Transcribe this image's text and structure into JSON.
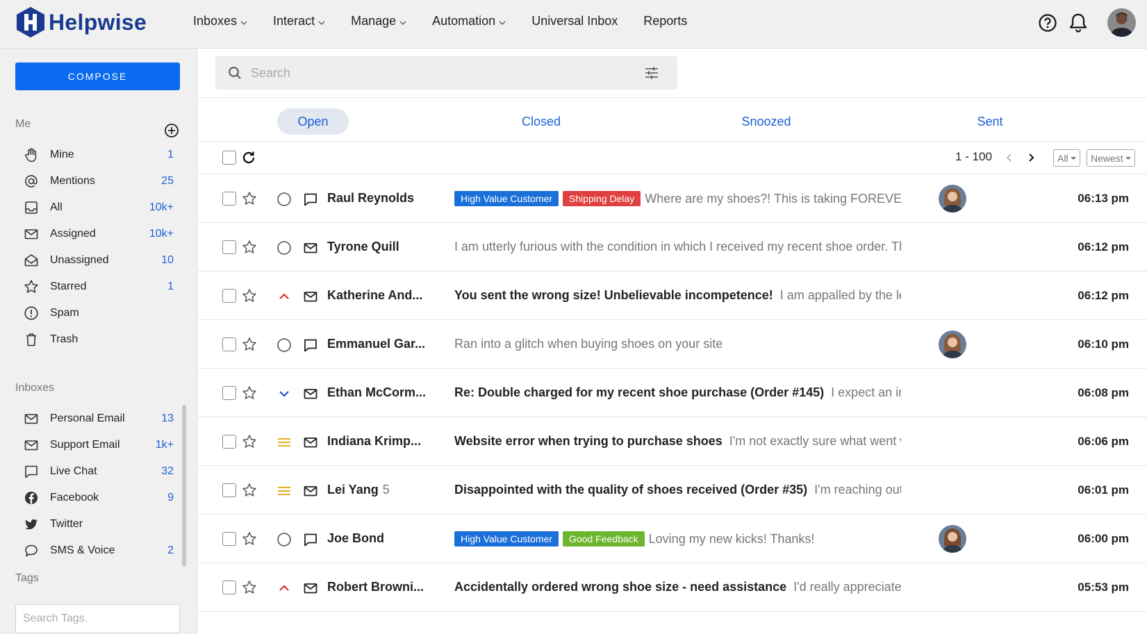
{
  "app": {
    "name": "Helpwise",
    "brand_color": "#1a3a8f",
    "accent_color": "#0a6bf0"
  },
  "nav": [
    {
      "label": "Inboxes",
      "dropdown": true
    },
    {
      "label": "Interact",
      "dropdown": true
    },
    {
      "label": "Manage",
      "dropdown": true
    },
    {
      "label": "Automation",
      "dropdown": true
    },
    {
      "label": "Universal Inbox",
      "dropdown": false
    },
    {
      "label": "Reports",
      "dropdown": false
    }
  ],
  "sidebar": {
    "compose_label": "COMPOSE",
    "me_label": "Me",
    "me_items": [
      {
        "label": "Mine",
        "count": "1",
        "icon": "hand-icon"
      },
      {
        "label": "Mentions",
        "count": "25",
        "icon": "at-icon"
      },
      {
        "label": "All",
        "count": "10k+",
        "icon": "inbox-tray-icon"
      },
      {
        "label": "Assigned",
        "count": "10k+",
        "icon": "envelope-icon"
      },
      {
        "label": "Unassigned",
        "count": "10",
        "icon": "open-envelope-icon"
      },
      {
        "label": "Starred",
        "count": "1",
        "icon": "star-icon"
      },
      {
        "label": "Spam",
        "count": "",
        "icon": "alert-circle-icon"
      },
      {
        "label": "Trash",
        "count": "",
        "icon": "trash-icon"
      }
    ],
    "inboxes_label": "Inboxes",
    "inboxes": [
      {
        "label": "Personal Email",
        "count": "13",
        "icon": "envelope-icon"
      },
      {
        "label": "Support Email",
        "count": "1k+",
        "icon": "envelope-icon"
      },
      {
        "label": "Live Chat",
        "count": "32",
        "icon": "chat-icon"
      },
      {
        "label": "Facebook",
        "count": "9",
        "icon": "facebook-icon"
      },
      {
        "label": "Twitter",
        "count": "",
        "icon": "twitter-icon"
      },
      {
        "label": "SMS & Voice",
        "count": "2",
        "icon": "speech-bubble-icon"
      }
    ],
    "tags_label": "Tags",
    "tags_search_placeholder": "Search Tags."
  },
  "search": {
    "placeholder": "Search"
  },
  "tabs": [
    {
      "label": "Open",
      "active": true
    },
    {
      "label": "Closed",
      "active": false
    },
    {
      "label": "Snoozed",
      "active": false
    },
    {
      "label": "Sent",
      "active": false
    }
  ],
  "toolbar": {
    "range": "1 - 100",
    "filter": "All",
    "sort": "Newest"
  },
  "conversations": [
    {
      "sender": "Raul Reynolds",
      "count": "",
      "status": "circle",
      "type": "chat",
      "tags": [
        {
          "label": "High Value Customer",
          "color": "#1a6fd8"
        },
        {
          "label": "Shipping Delay",
          "color": "#e04040"
        }
      ],
      "subject": "",
      "preview": "Where are my shoes?! This is taking FOREVER",
      "avatar": true,
      "time": "06:13 pm"
    },
    {
      "sender": "Tyrone Quill",
      "count": "",
      "status": "circle",
      "type": "mail",
      "tags": [],
      "subject": "",
      "preview": "I am utterly furious with the condition in which I received my recent shoe order. The",
      "avatar": false,
      "time": "06:12 pm"
    },
    {
      "sender": "Katherine And...",
      "count": "",
      "status": "priority-high",
      "type": "mail",
      "tags": [],
      "subject": "You sent the wrong size! Unbelievable incompetence!",
      "preview": "I am appalled by the lev",
      "avatar": false,
      "time": "06:12 pm"
    },
    {
      "sender": "Emmanuel Gar...",
      "count": "",
      "status": "circle",
      "type": "chat",
      "tags": [],
      "subject": "",
      "preview": "Ran into a glitch when buying shoes on your site",
      "avatar": true,
      "time": "06:10 pm"
    },
    {
      "sender": "Ethan McCorm...",
      "count": "",
      "status": "priority-low",
      "type": "mail",
      "tags": [],
      "subject": "Re: Double charged for my recent shoe purchase (Order #145)",
      "preview": "I expect an im",
      "avatar": false,
      "time": "06:08 pm"
    },
    {
      "sender": "Indiana Krimp...",
      "count": "",
      "status": "priority-medium",
      "type": "mail",
      "tags": [],
      "subject": "Website error when trying to purchase shoes",
      "preview": "I'm not exactly sure what went w",
      "avatar": false,
      "time": "06:06 pm"
    },
    {
      "sender": "Lei Yang",
      "count": "5",
      "status": "priority-medium",
      "type": "mail",
      "tags": [],
      "subject": "Disappointed with the quality of shoes received (Order #35)",
      "preview": "I'm reaching out t",
      "avatar": false,
      "time": "06:01 pm"
    },
    {
      "sender": "Joe Bond",
      "count": "",
      "status": "circle",
      "type": "chat",
      "tags": [
        {
          "label": "High Value Customer",
          "color": "#1a6fd8"
        },
        {
          "label": "Good Feedback",
          "color": "#6cb52d"
        }
      ],
      "subject": "",
      "preview": "Loving my new kicks! Thanks!",
      "avatar": true,
      "time": "06:00 pm"
    },
    {
      "sender": "Robert Browni...",
      "count": "",
      "status": "priority-high",
      "type": "mail",
      "tags": [],
      "subject": "Accidentally ordered wrong shoe size - need assistance",
      "preview": "I'd really appreciate i",
      "avatar": false,
      "time": "05:53 pm"
    }
  ]
}
